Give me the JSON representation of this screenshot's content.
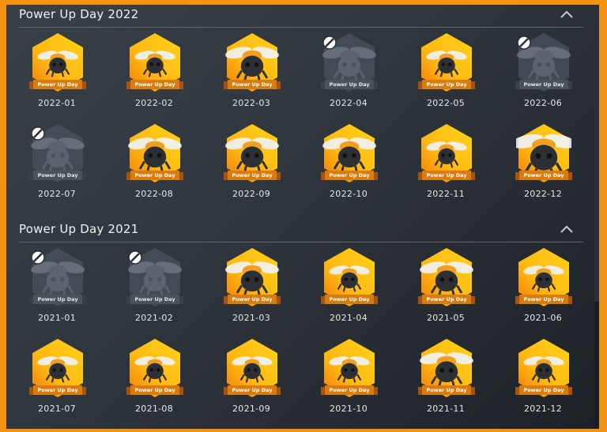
{
  "colors": {
    "accent_border": "#f39314",
    "panel_bg": "#2f353c",
    "hex_gold_light": "#ffd21a",
    "hex_gold_dark": "#f07a0a",
    "ribbon": "#d97c10",
    "locked_hex": "#4a525c"
  },
  "sections": [
    {
      "title": "Power Up Day 2022",
      "collapse_icon": "chevron-up-icon",
      "badges": [
        {
          "label": "2022-01",
          "ribbon": "Power Up Day",
          "locked": false,
          "bee": "small"
        },
        {
          "label": "2022-02",
          "ribbon": "Power Up Day",
          "locked": false,
          "bee": "small"
        },
        {
          "label": "2022-03",
          "ribbon": "Power Up Day",
          "locked": false,
          "bee": "medium"
        },
        {
          "label": "2022-04",
          "ribbon": "Power Up Day",
          "locked": true,
          "bee": "medium"
        },
        {
          "label": "2022-05",
          "ribbon": "Power Up Day",
          "locked": false,
          "bee": "small"
        },
        {
          "label": "2022-06",
          "ribbon": "Power Up Day",
          "locked": true,
          "bee": "medium"
        },
        {
          "label": "2022-07",
          "ribbon": "Power Up Day",
          "locked": true,
          "bee": "medium"
        },
        {
          "label": "2022-08",
          "ribbon": "Power Up Day",
          "locked": false,
          "bee": "medium"
        },
        {
          "label": "2022-09",
          "ribbon": "Power Up Day",
          "locked": false,
          "bee": "medium"
        },
        {
          "label": "2022-10",
          "ribbon": "Power Up Day",
          "locked": false,
          "bee": "medium"
        },
        {
          "label": "2022-11",
          "ribbon": "Power Up Day",
          "locked": false,
          "bee": "small"
        },
        {
          "label": "2022-12",
          "ribbon": "Power Up Day",
          "locked": false,
          "bee": "large"
        }
      ]
    },
    {
      "title": "Power Up Day 2021",
      "collapse_icon": "chevron-up-icon",
      "badges": [
        {
          "label": "2021-01",
          "ribbon": "Power Up Day",
          "locked": true,
          "bee": "medium"
        },
        {
          "label": "2021-02",
          "ribbon": "Power Up Day",
          "locked": true,
          "bee": "medium"
        },
        {
          "label": "2021-03",
          "ribbon": "Power Up Day",
          "locked": false,
          "bee": "medium"
        },
        {
          "label": "2021-04",
          "ribbon": "Power Up Day",
          "locked": false,
          "bee": "small"
        },
        {
          "label": "2021-05",
          "ribbon": "Power Up Day",
          "locked": false,
          "bee": "medium"
        },
        {
          "label": "2021-06",
          "ribbon": "Power Up Day",
          "locked": false,
          "bee": "small"
        },
        {
          "label": "2021-07",
          "ribbon": "Power Up Day",
          "locked": false,
          "bee": "small"
        },
        {
          "label": "2021-08",
          "ribbon": "Power Up Day",
          "locked": false,
          "bee": "small"
        },
        {
          "label": "2021-09",
          "ribbon": "Power Up Day",
          "locked": false,
          "bee": "small"
        },
        {
          "label": "2021-10",
          "ribbon": "Power Up Day",
          "locked": false,
          "bee": "small"
        },
        {
          "label": "2021-11",
          "ribbon": "Power Up Day",
          "locked": false,
          "bee": "medium"
        },
        {
          "label": "2021-12",
          "ribbon": "Power Up Day",
          "locked": false,
          "bee": "small"
        }
      ]
    }
  ]
}
